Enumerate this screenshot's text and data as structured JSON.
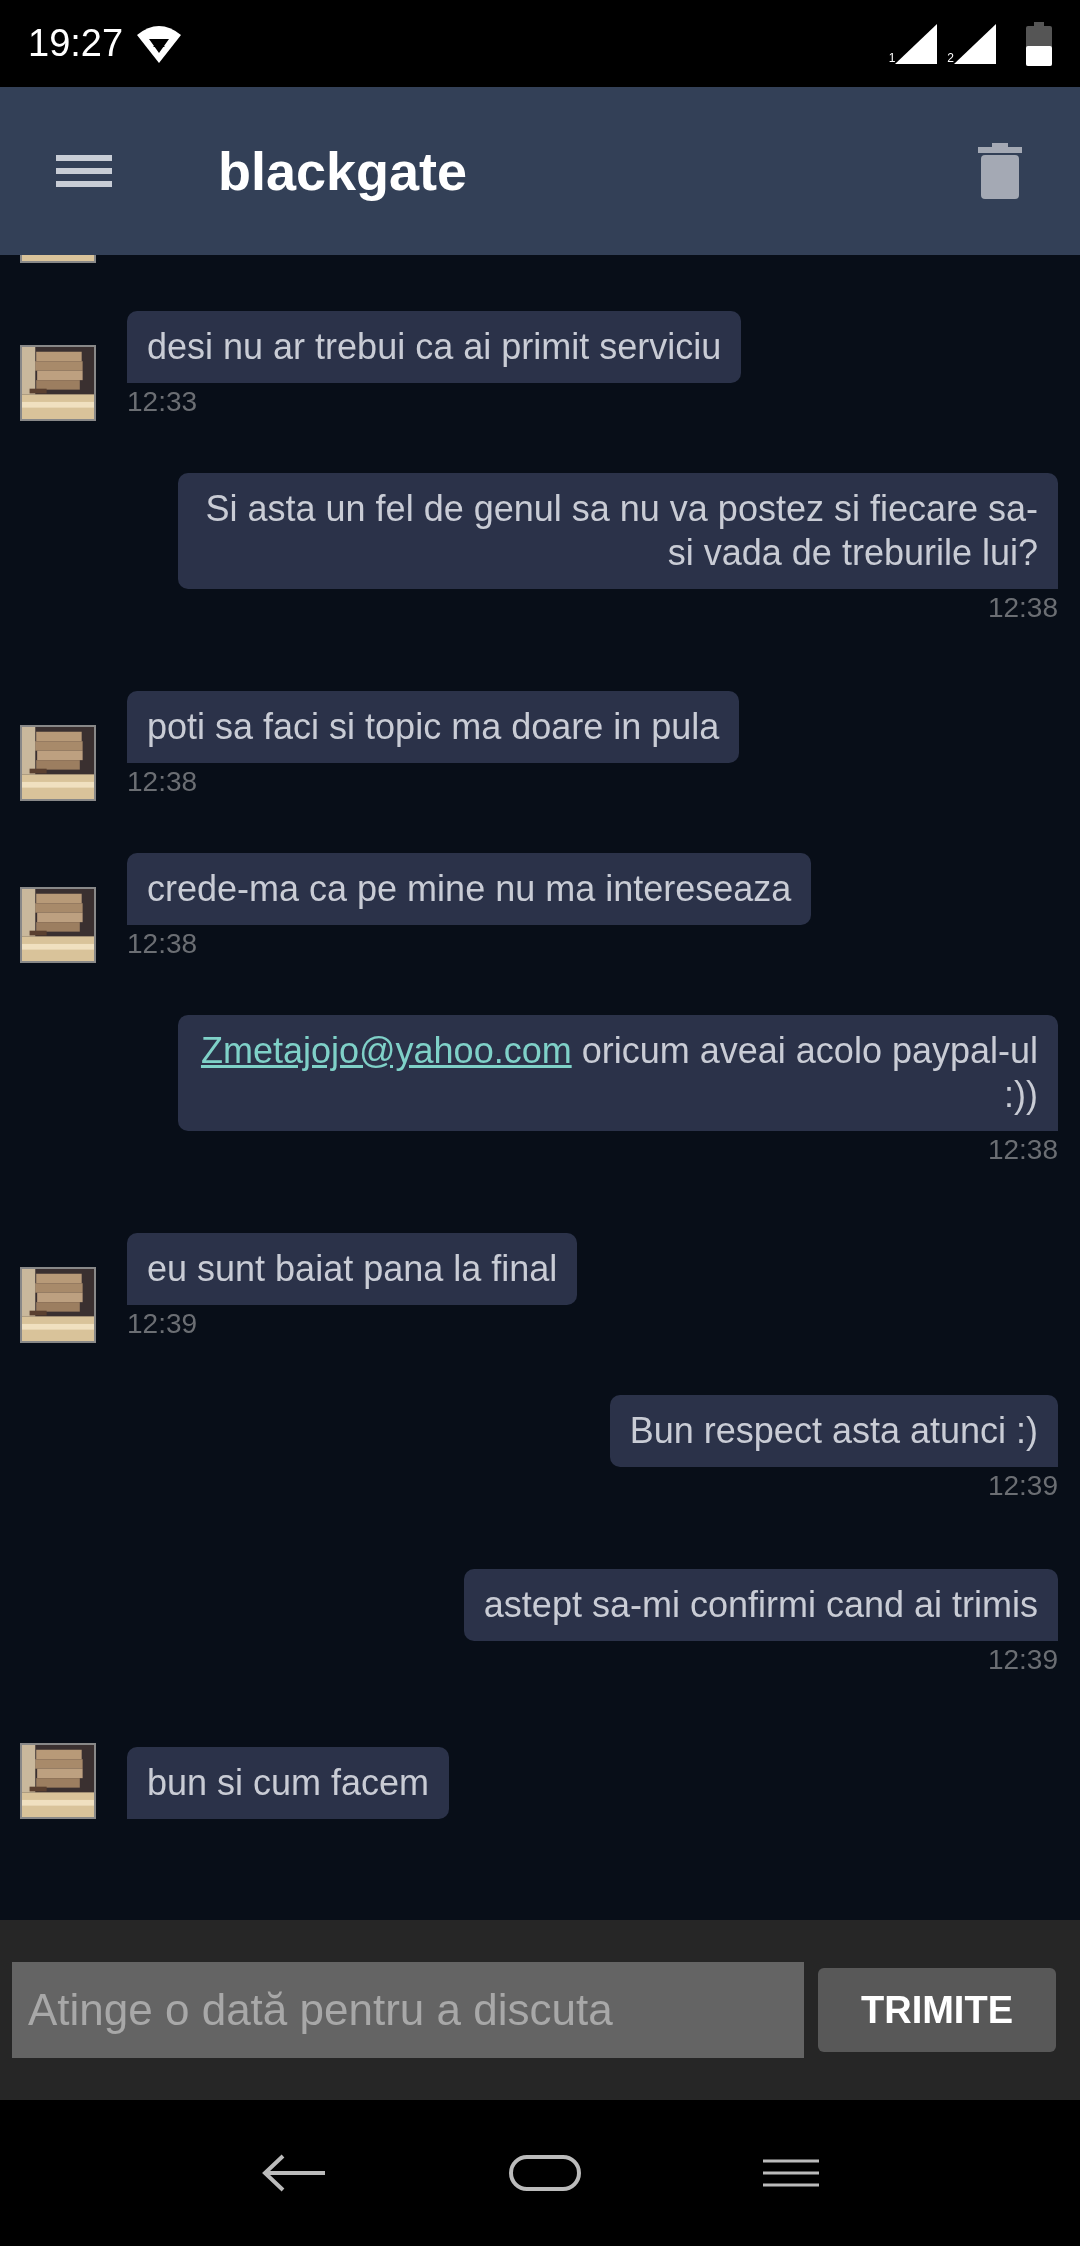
{
  "status_bar": {
    "time": "19:27",
    "sim_labels": [
      "1",
      "2"
    ]
  },
  "app_bar": {
    "title": "blackgate"
  },
  "messages": [
    {
      "kind": "received",
      "text": "desi nu ar trebui ca ai primit serviciu",
      "time": "12:33"
    },
    {
      "kind": "sent",
      "text": "Si asta un fel de genul sa nu va postez si fiecare sa-si vada de treburile lui?",
      "time": "12:38"
    },
    {
      "kind": "received",
      "text": "poti sa faci si topic ma doare in pula",
      "time": "12:38"
    },
    {
      "kind": "received",
      "text": "crede-ma ca pe mine nu ma intereseaza",
      "time": "12:38"
    },
    {
      "kind": "sent",
      "link": "Zmetajojo@yahoo.com",
      "text": "oricum aveai acolo paypal-ul :))",
      "time": "12:38"
    },
    {
      "kind": "received",
      "text": "eu sunt baiat pana la final",
      "time": "12:39"
    },
    {
      "kind": "sent",
      "text": "Bun respect asta atunci :)",
      "time": "12:39"
    },
    {
      "kind": "sent",
      "text": "astept sa-mi confirmi cand ai  trimis",
      "time": "12:39"
    },
    {
      "kind": "received",
      "text": "bun si cum facem"
    }
  ],
  "composer": {
    "placeholder": "Atinge o dată pentru a discuta",
    "send_button": "TRIMITE"
  }
}
